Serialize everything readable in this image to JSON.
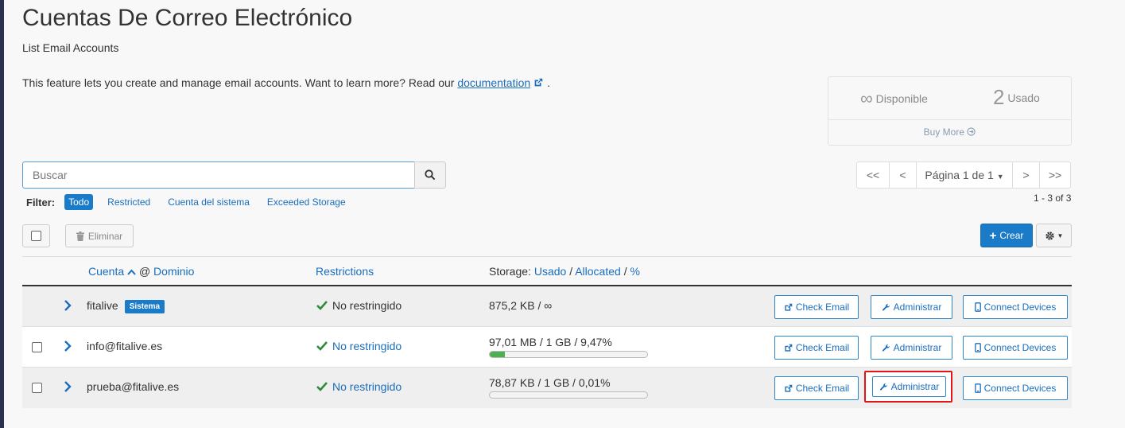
{
  "header": {
    "title": "Cuentas De Correo Electrónico",
    "subtitle": "List Email Accounts",
    "intro_text": "This feature lets you create and manage email accounts. Want to learn more? Read our ",
    "intro_link": "documentation",
    "intro_end": "."
  },
  "stats": {
    "available_value": "∞",
    "available_label": "Disponible",
    "used_value": "2",
    "used_label": "Usado",
    "buy_more": "Buy More"
  },
  "search": {
    "placeholder": "Buscar"
  },
  "pagination": {
    "first": "<<",
    "prev": "<",
    "page_label": "Página 1 de 1",
    "next": ">",
    "last": ">>",
    "count": "1 - 3 of 3"
  },
  "filter": {
    "label": "Filter:",
    "options": [
      "Todo",
      "Restricted",
      "Cuenta del sistema",
      "Exceeded Storage"
    ],
    "active": "Todo"
  },
  "toolbar": {
    "delete_label": "Eliminar",
    "create_label": "Crear"
  },
  "table": {
    "headers": {
      "account": "Cuenta",
      "at": "@",
      "domain": "Dominio",
      "restrictions": "Restrictions",
      "storage_prefix": "Storage:",
      "storage_used": "Usado",
      "storage_allocated": "Allocated",
      "storage_percent": "%",
      "slash": "/"
    },
    "rows": [
      {
        "account": "fitalive",
        "badge": "Sistema",
        "restriction": "No restringido",
        "storage": "875,2 KB / ∞",
        "usage_percent": null
      },
      {
        "account": "info@fitalive.es",
        "badge": "",
        "restriction": "No restringido",
        "storage": "97,01 MB / 1 GB / 9,47%",
        "usage_percent": 9.47
      },
      {
        "account": "prueba@fitalive.es",
        "badge": "",
        "restriction": "No restringido",
        "storage": "78,87 KB / 1 GB / 0,01%",
        "usage_percent": 0.01
      }
    ],
    "actions": {
      "check_email": "Check Email",
      "manage": "Administrar",
      "connect_devices": "Connect Devices"
    }
  },
  "colors": {
    "primary": "#1a7bc9",
    "link": "#1a6ebd",
    "success": "#2e8b3a",
    "highlight": "#e4141b"
  }
}
